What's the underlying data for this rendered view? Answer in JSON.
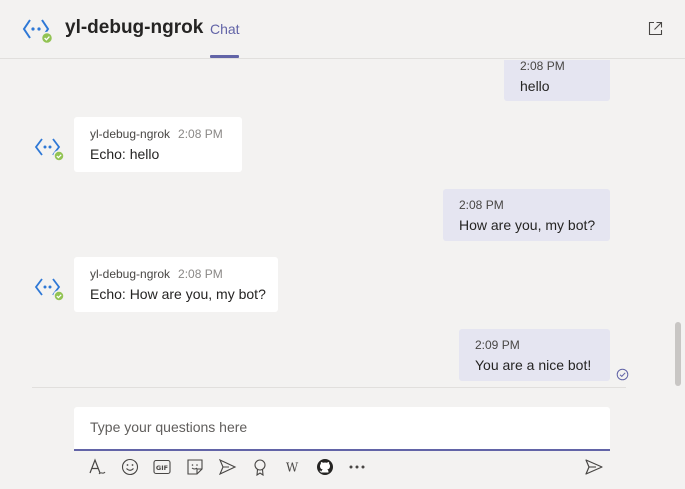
{
  "header": {
    "title": "yl-debug-ngrok",
    "tab_label": "Chat"
  },
  "colors": {
    "accent": "#6264a7",
    "bot_blue": "#2e78d6",
    "presence_green": "#92c353",
    "sent_bubble": "#e5e5f1",
    "recv_bubble": "#ffffff"
  },
  "messages": [
    {
      "direction": "sent",
      "time": "2:08 PM",
      "text": "hello"
    },
    {
      "direction": "received",
      "sender": "yl-debug-ngrok",
      "time": "2:08 PM",
      "text": "Echo: hello"
    },
    {
      "direction": "sent",
      "time": "2:08 PM",
      "text": "How are you, my bot?"
    },
    {
      "direction": "received",
      "sender": "yl-debug-ngrok",
      "time": "2:08 PM",
      "text": "Echo: How are you, my bot?"
    },
    {
      "direction": "sent",
      "time": "2:09 PM",
      "text": "You are a nice bot!"
    }
  ],
  "compose": {
    "placeholder": "Type your questions here"
  },
  "toolbar": {
    "icons": [
      "format-icon",
      "emoji-icon",
      "gif-icon",
      "sticker-icon",
      "meet-icon",
      "praise-icon",
      "wiki-icon",
      "github-icon",
      "more-options-icon",
      "send-icon"
    ],
    "gif_label": "GIF",
    "wiki_label": "W"
  }
}
